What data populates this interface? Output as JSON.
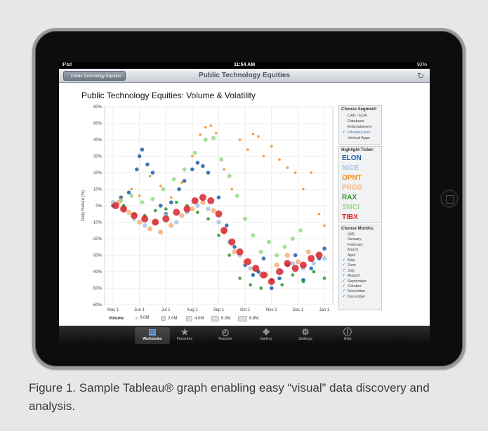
{
  "status": {
    "carrier": "iPad",
    "time": "11:54 AM",
    "battery": "92%"
  },
  "nav": {
    "back_label": "Public Technology Equities",
    "title": "Public Technology Equities"
  },
  "chart_data": {
    "type": "scatter",
    "title": "Public Technology Equities: Volume & Volatility",
    "ylabel": "Daily Return (%)",
    "ylim": [
      -80,
      80
    ],
    "yticks": [
      "80%",
      "60%",
      "40%",
      "30%",
      "20%",
      "10%",
      "0%",
      "-10%",
      "-20%",
      "-30%",
      "-40%",
      "-50%",
      "-60%"
    ],
    "yticks_values": [
      80,
      60,
      40,
      30,
      20,
      10,
      0,
      -10,
      -20,
      -30,
      -40,
      -50,
      -60
    ],
    "xticks": [
      "May 1",
      "Jun 1",
      "Jul 1",
      "Aug 1",
      "Sep 1",
      "Oct 1",
      "Nov 1",
      "Dec 1",
      "Jan 1"
    ],
    "series": [
      {
        "name": "ELON",
        "color": "#1f5fa8",
        "values": [
          [
            0,
            0
          ],
          [
            0.3,
            5
          ],
          [
            0.6,
            8
          ],
          [
            0.9,
            22
          ],
          [
            1.0,
            30
          ],
          [
            1.1,
            34
          ],
          [
            1.3,
            25
          ],
          [
            1.5,
            20
          ],
          [
            1.8,
            0
          ],
          [
            2.0,
            -5
          ],
          [
            2.2,
            2
          ],
          [
            2.5,
            10
          ],
          [
            2.7,
            15
          ],
          [
            3.0,
            22
          ],
          [
            3.2,
            26
          ],
          [
            3.4,
            24
          ],
          [
            3.6,
            20
          ],
          [
            4.0,
            5
          ],
          [
            4.3,
            -12
          ],
          [
            4.6,
            -25
          ],
          [
            5.0,
            -36
          ],
          [
            5.3,
            -42
          ],
          [
            5.5,
            -40
          ],
          [
            5.7,
            -32
          ],
          [
            6.0,
            -50
          ],
          [
            6.3,
            -44
          ],
          [
            6.6,
            -36
          ],
          [
            6.9,
            -30
          ],
          [
            7.2,
            -45
          ],
          [
            7.5,
            -38
          ],
          [
            7.8,
            -32
          ],
          [
            8.0,
            -26
          ]
        ]
      },
      {
        "name": "NICE",
        "color": "#a9c4e4",
        "values": [
          [
            0,
            2
          ],
          [
            0.4,
            -2
          ],
          [
            0.8,
            -8
          ],
          [
            1.2,
            -12
          ],
          [
            1.6,
            -10
          ],
          [
            2.0,
            -6
          ],
          [
            2.4,
            -10
          ],
          [
            2.8,
            -4
          ],
          [
            3.2,
            0
          ],
          [
            3.6,
            -2
          ],
          [
            4.0,
            -10
          ],
          [
            4.4,
            -22
          ],
          [
            4.8,
            -30
          ],
          [
            5.2,
            -38
          ],
          [
            5.6,
            -42
          ],
          [
            6.0,
            -45
          ],
          [
            6.4,
            -40
          ],
          [
            6.8,
            -35
          ],
          [
            7.2,
            -38
          ],
          [
            7.6,
            -35
          ],
          [
            8.0,
            -32
          ]
        ]
      },
      {
        "name": "OPNT",
        "color": "#f28a1e",
        "values": [
          [
            0.3,
            4
          ],
          [
            0.7,
            10
          ],
          [
            1.0,
            6
          ],
          [
            1.4,
            18
          ],
          [
            1.8,
            12
          ],
          [
            2.2,
            5
          ],
          [
            2.6,
            14
          ],
          [
            3.0,
            30
          ],
          [
            3.3,
            46
          ],
          [
            3.5,
            55
          ],
          [
            3.7,
            57
          ],
          [
            3.9,
            48
          ],
          [
            4.2,
            22
          ],
          [
            4.5,
            10
          ],
          [
            4.8,
            40
          ],
          [
            5.1,
            34
          ],
          [
            5.3,
            47
          ],
          [
            5.5,
            44
          ],
          [
            5.7,
            30
          ],
          [
            6.0,
            36
          ],
          [
            6.3,
            28
          ],
          [
            6.6,
            23
          ],
          [
            6.9,
            20
          ],
          [
            7.2,
            10
          ],
          [
            7.5,
            20
          ],
          [
            7.8,
            -5
          ],
          [
            8.0,
            -12
          ]
        ]
      },
      {
        "name": "PRGS",
        "color": "#f7b27a",
        "values": [
          [
            0.2,
            2
          ],
          [
            0.6,
            -4
          ],
          [
            1.0,
            -10
          ],
          [
            1.4,
            -14
          ],
          [
            1.8,
            -16
          ],
          [
            2.2,
            -12
          ],
          [
            2.6,
            -6
          ],
          [
            3.0,
            -2
          ],
          [
            3.4,
            2
          ],
          [
            3.8,
            -3
          ],
          [
            4.2,
            -16
          ],
          [
            4.6,
            -28
          ],
          [
            5.0,
            -34
          ],
          [
            5.4,
            -38
          ],
          [
            5.8,
            -42
          ],
          [
            6.2,
            -36
          ],
          [
            6.6,
            -30
          ],
          [
            7.0,
            -34
          ],
          [
            7.4,
            -28
          ],
          [
            7.8,
            -30
          ]
        ]
      },
      {
        "name": "RAX",
        "color": "#2e9a2e",
        "values": [
          [
            0.4,
            0
          ],
          [
            0.8,
            -5
          ],
          [
            1.2,
            -6
          ],
          [
            1.6,
            -3
          ],
          [
            2.0,
            -2
          ],
          [
            2.4,
            2
          ],
          [
            2.8,
            0
          ],
          [
            3.2,
            -4
          ],
          [
            3.6,
            -8
          ],
          [
            4.0,
            -18
          ],
          [
            4.4,
            -30
          ],
          [
            4.8,
            -44
          ],
          [
            5.2,
            -48
          ],
          [
            5.6,
            -50
          ],
          [
            6.0,
            -45
          ],
          [
            6.4,
            -48
          ],
          [
            6.8,
            -42
          ],
          [
            7.2,
            -46
          ],
          [
            7.6,
            -40
          ],
          [
            8.0,
            -44
          ]
        ]
      },
      {
        "name": "SMCI",
        "color": "#98d88a",
        "values": [
          [
            0.3,
            3
          ],
          [
            0.7,
            6
          ],
          [
            1.1,
            2
          ],
          [
            1.5,
            4
          ],
          [
            1.9,
            10
          ],
          [
            2.3,
            16
          ],
          [
            2.7,
            22
          ],
          [
            3.1,
            32
          ],
          [
            3.5,
            40
          ],
          [
            3.8,
            42
          ],
          [
            4.1,
            28
          ],
          [
            4.4,
            18
          ],
          [
            4.7,
            6
          ],
          [
            5.0,
            -8
          ],
          [
            5.3,
            -18
          ],
          [
            5.6,
            -28
          ],
          [
            5.9,
            -22
          ],
          [
            6.2,
            -30
          ],
          [
            6.5,
            -25
          ],
          [
            6.8,
            -20
          ],
          [
            7.1,
            -15
          ]
        ]
      },
      {
        "name": "TIBX",
        "color": "#d8262e",
        "values": [
          [
            0.1,
            0
          ],
          [
            0.4,
            -2
          ],
          [
            0.8,
            -6
          ],
          [
            1.2,
            -8
          ],
          [
            1.6,
            -10
          ],
          [
            2.0,
            -8
          ],
          [
            2.4,
            -4
          ],
          [
            2.8,
            -2
          ],
          [
            3.1,
            3
          ],
          [
            3.4,
            5
          ],
          [
            3.7,
            3
          ],
          [
            4.0,
            -5
          ],
          [
            4.2,
            -15
          ],
          [
            4.5,
            -22
          ],
          [
            4.8,
            -28
          ],
          [
            5.1,
            -34
          ],
          [
            5.4,
            -38
          ],
          [
            5.7,
            -42
          ],
          [
            6.0,
            -46
          ],
          [
            6.3,
            -40
          ],
          [
            6.6,
            -35
          ],
          [
            6.9,
            -38
          ],
          [
            7.2,
            -36
          ],
          [
            7.5,
            -32
          ],
          [
            7.8,
            -30
          ]
        ]
      }
    ]
  },
  "segments": {
    "title": "Choose Segment:",
    "items": [
      {
        "label": "CAD / EDA",
        "checked": false
      },
      {
        "label": "Database",
        "checked": false
      },
      {
        "label": "Entertainment",
        "checked": false
      },
      {
        "label": "Infrastructure",
        "checked": true
      },
      {
        "label": "Vertical Apps",
        "checked": false
      }
    ]
  },
  "tickers": {
    "title": "Highlight Ticker:",
    "items": [
      {
        "label": "ELON",
        "color": "#1f5fa8"
      },
      {
        "label": "NICE",
        "color": "#a9c4e4"
      },
      {
        "label": "OPNT",
        "color": "#f28a1e"
      },
      {
        "label": "PRGS",
        "color": "#f7b27a"
      },
      {
        "label": "RAX",
        "color": "#2e9a2e"
      },
      {
        "label": "SMCI",
        "color": "#98d88a"
      },
      {
        "label": "TIBX",
        "color": "#d8262e"
      }
    ]
  },
  "months": {
    "title": "Choose Months:",
    "items": [
      {
        "label": "(All)",
        "checked": false
      },
      {
        "label": "January",
        "checked": false
      },
      {
        "label": "February",
        "checked": false
      },
      {
        "label": "March",
        "checked": false
      },
      {
        "label": "April",
        "checked": false
      },
      {
        "label": "May",
        "checked": true
      },
      {
        "label": "June",
        "checked": true
      },
      {
        "label": "July",
        "checked": true
      },
      {
        "label": "August",
        "checked": true
      },
      {
        "label": "September",
        "checked": true
      },
      {
        "label": "October",
        "checked": true
      },
      {
        "label": "November",
        "checked": true
      },
      {
        "label": "December",
        "checked": true
      }
    ]
  },
  "legend": {
    "label": "Volume",
    "items": [
      "0.0M",
      "2.0M",
      "4.0M",
      "6.0M",
      "8.9M"
    ]
  },
  "tabs": [
    {
      "label": "Workbooks",
      "icon": "chart-icon",
      "active": true
    },
    {
      "label": "Favorites",
      "icon": "star-icon",
      "active": false
    },
    {
      "label": "Recents",
      "icon": "clock-icon",
      "active": false
    },
    {
      "label": "Gallery",
      "icon": "gallery-icon",
      "active": false
    },
    {
      "label": "Settings",
      "icon": "gear-icon",
      "active": false
    },
    {
      "label": "Help",
      "icon": "info-icon",
      "active": false
    }
  ],
  "caption": "Figure 1. Sample Tableau® graph enabling easy “visual” data discovery and analysis."
}
